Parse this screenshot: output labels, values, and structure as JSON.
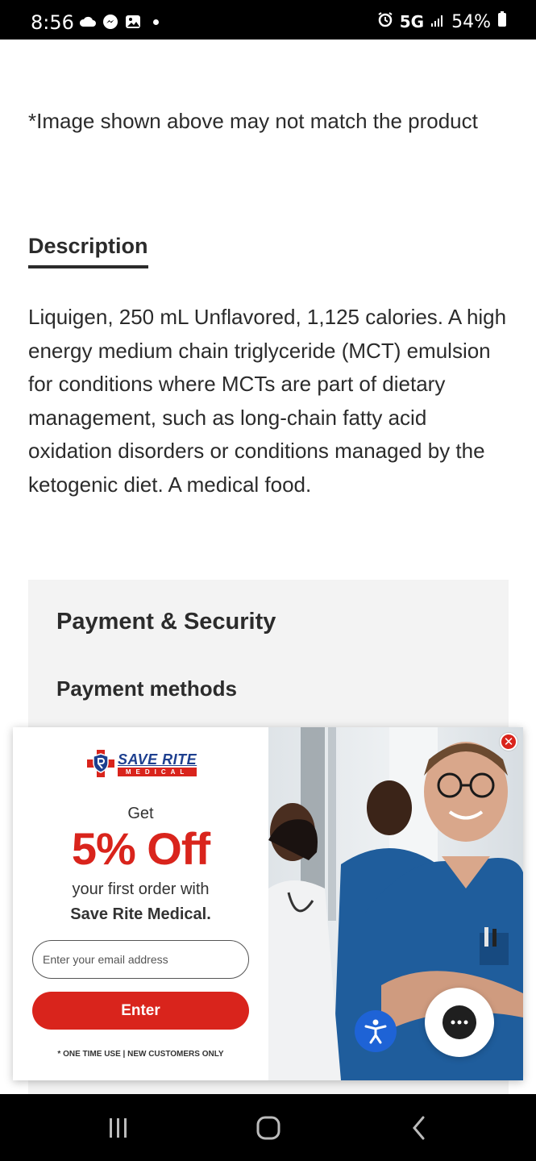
{
  "status_bar": {
    "time": "8:56",
    "network": "5G",
    "battery": "54%",
    "icons": [
      "cloud-icon",
      "messenger-icon",
      "gallery-icon",
      "notification-dot",
      "alarm-icon",
      "signal-icon",
      "battery-icon"
    ]
  },
  "page": {
    "image_note": "*Image shown above may not match the product",
    "description_heading": "Description",
    "description_body": "Liquigen, 250 mL Unflavored, 1,125 calories. A high energy medium chain triglyceride (MCT) emulsion for conditions where MCTs are part of dietary management, such as long-chain fatty acid oxidation disorders or conditions managed by the ketogenic diet. A medical food.",
    "payment_title": "Payment & Security",
    "payment_methods_label": "Payment methods"
  },
  "popup": {
    "logo_name": "SAVE RITE",
    "logo_sub": "MEDICAL",
    "get_text": "Get",
    "offer": "5% Off",
    "line1": "your first order with",
    "line2": "Save Rite Medical.",
    "email_placeholder": "Enter your email address",
    "enter_label": "Enter",
    "fine_print": "* ONE TIME USE | NEW CUSTOMERS ONLY",
    "close_label": "✕"
  },
  "colors": {
    "brand_red": "#d9241c",
    "brand_blue": "#1d3f8f",
    "a11y_blue": "#1e63d6"
  }
}
